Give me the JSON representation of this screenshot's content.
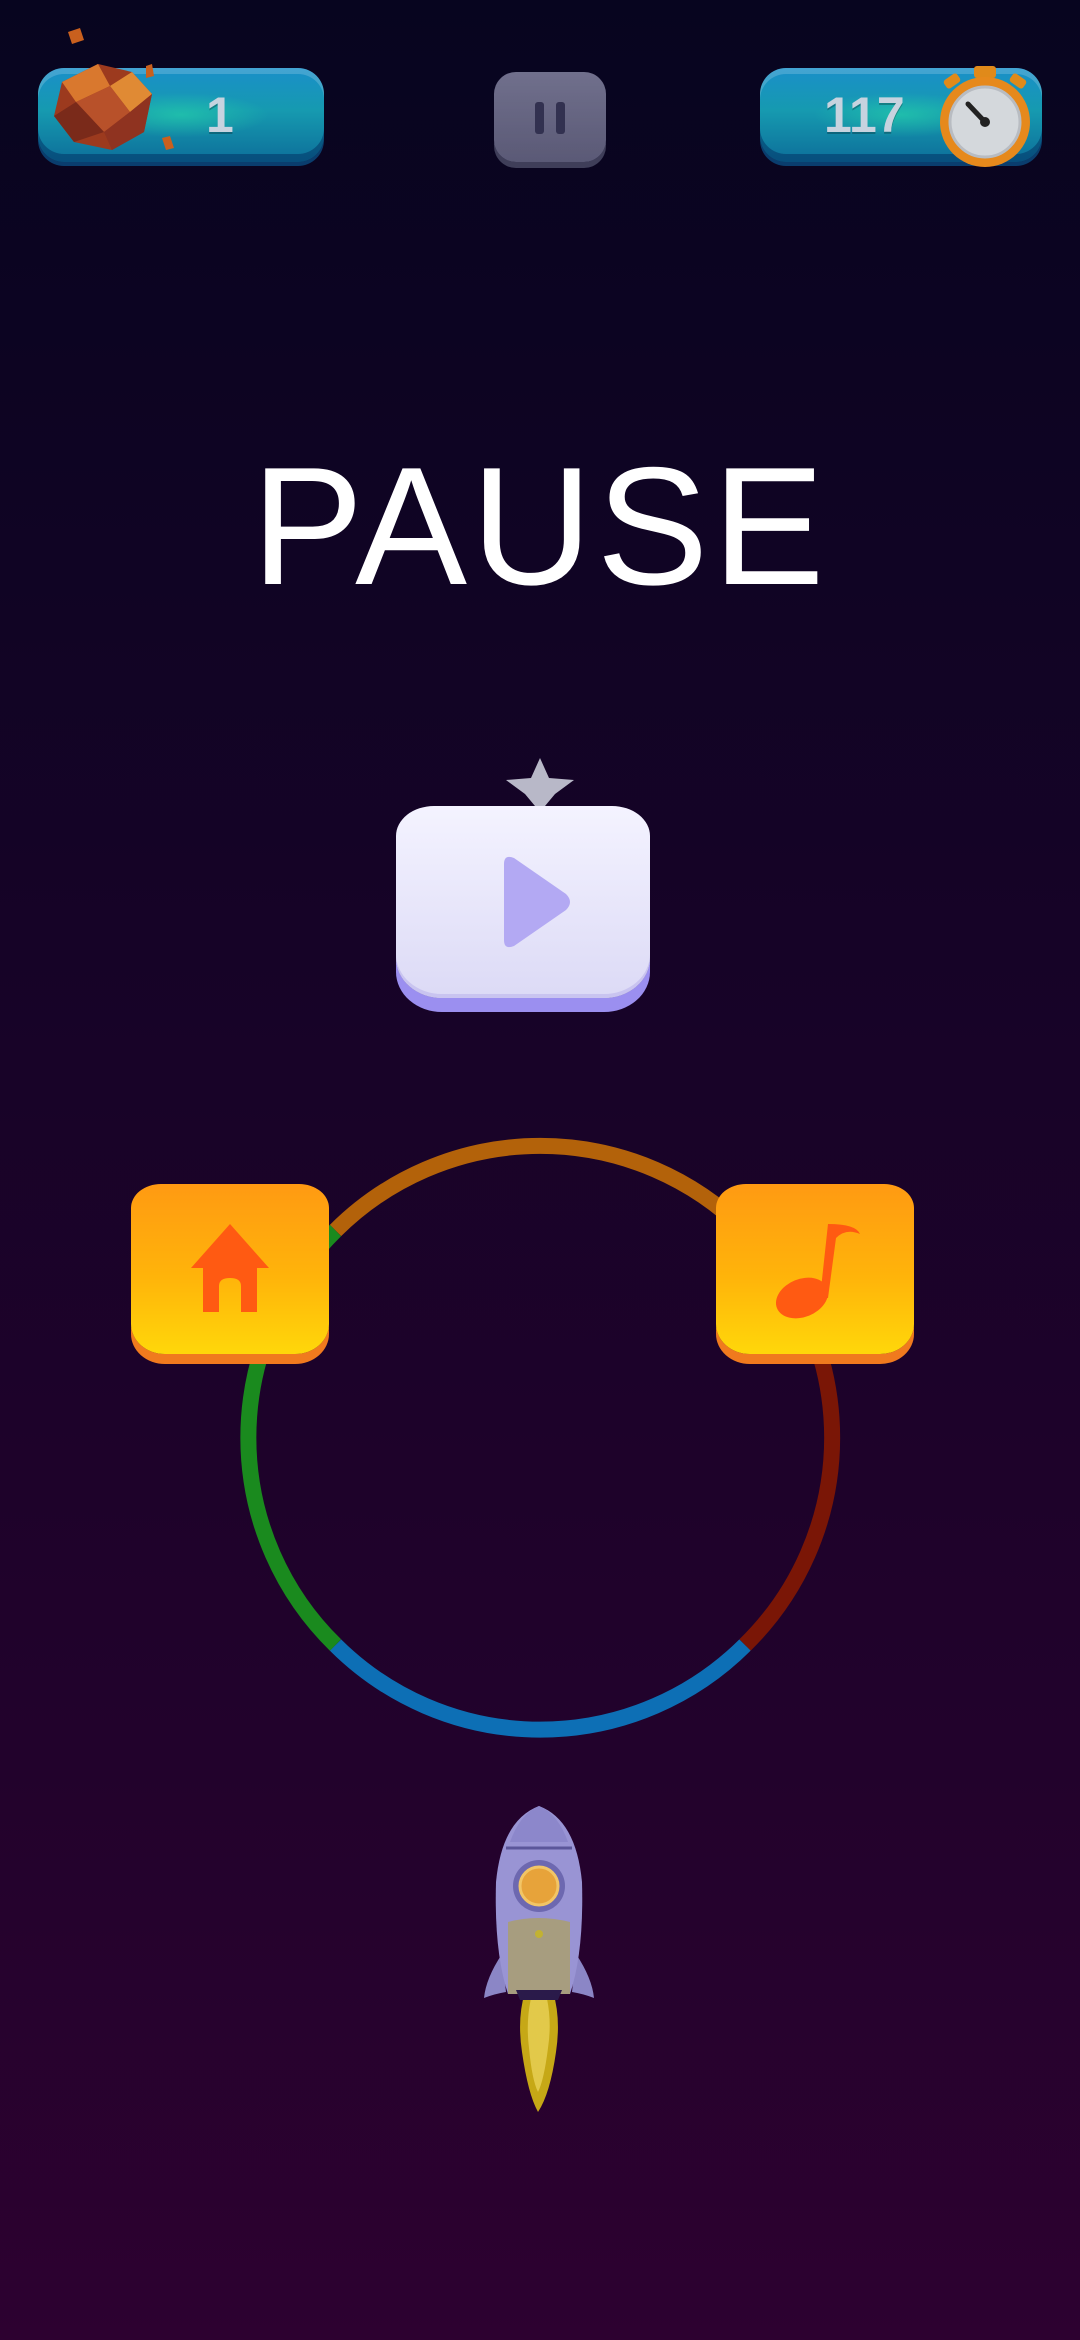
{
  "hud": {
    "asteroid_count": "1",
    "timer_value": "117"
  },
  "pause_screen": {
    "title": "PAUSE",
    "buttons": [
      {
        "name": "resume",
        "icon": "play-icon"
      },
      {
        "name": "home",
        "icon": "home-icon"
      },
      {
        "name": "music",
        "icon": "music-note-icon"
      }
    ]
  },
  "colors": {
    "background_top": "#07051f",
    "background_bottom": "#2d0130",
    "hud_pill": "#169ab0",
    "orange_button": "#ffb40a",
    "play_button": "#e6e4fa",
    "play_icon": "#b3a9f3",
    "ring_segments": [
      "#b3620a",
      "#7a1606",
      "#0d6fb5",
      "#1a8a1e"
    ]
  }
}
